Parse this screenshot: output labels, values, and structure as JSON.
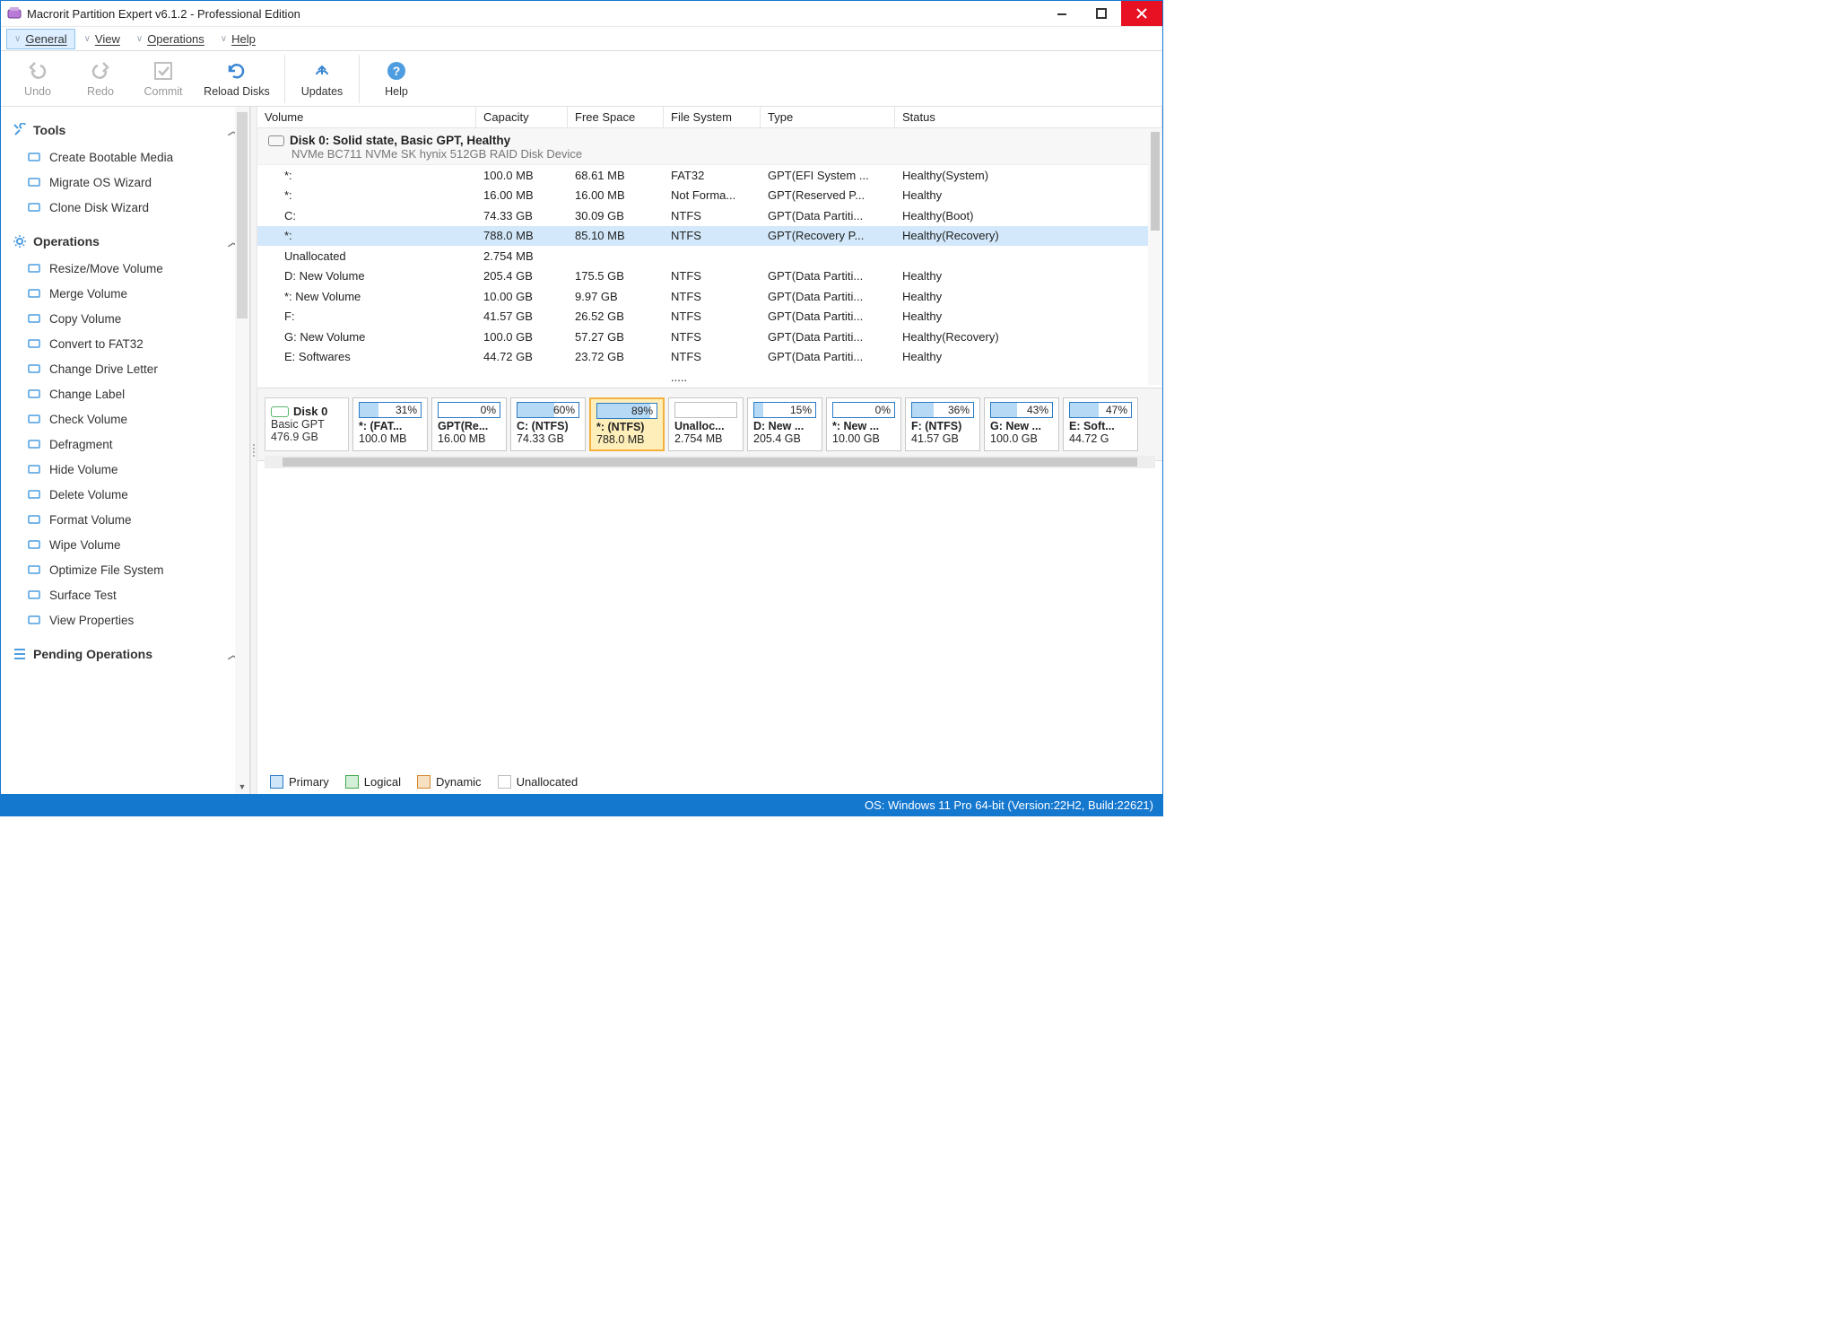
{
  "title": "Macrorit Partition Expert v6.1.2 - Professional Edition",
  "menus": {
    "general": "General",
    "view": "View",
    "operations": "Operations",
    "help": "Help"
  },
  "toolbar": {
    "undo": "Undo",
    "redo": "Redo",
    "commit": "Commit",
    "reload": "Reload Disks",
    "updates": "Updates",
    "help": "Help"
  },
  "sidebar": {
    "tools": {
      "title": "Tools",
      "items": [
        "Create Bootable Media",
        "Migrate OS Wizard",
        "Clone Disk Wizard"
      ]
    },
    "ops": {
      "title": "Operations",
      "items": [
        "Resize/Move Volume",
        "Merge Volume",
        "Copy Volume",
        "Convert to FAT32",
        "Change Drive Letter",
        "Change Label",
        "Check Volume",
        "Defragment",
        "Hide Volume",
        "Delete Volume",
        "Format Volume",
        "Wipe Volume",
        "Optimize File System",
        "Surface Test",
        "View Properties"
      ]
    },
    "pending": {
      "title": "Pending Operations"
    }
  },
  "columns": [
    "Volume",
    "Capacity",
    "Free Space",
    "File System",
    "Type",
    "Status"
  ],
  "disk": {
    "title": "Disk 0: Solid state, Basic GPT, Healthy",
    "sub": "NVMe BC711 NVMe SK hynix 512GB RAID Disk Device",
    "graph_name": "Disk 0",
    "graph_sub1": "Basic GPT",
    "graph_sub2": "476.9 GB"
  },
  "volumes": [
    {
      "name": "*:",
      "cap": "100.0 MB",
      "free": "68.61 MB",
      "fs": "FAT32",
      "type": "GPT(EFI System ...",
      "status": "Healthy(System)"
    },
    {
      "name": "*:",
      "cap": "16.00 MB",
      "free": "16.00 MB",
      "fs": "Not Forma...",
      "type": "GPT(Reserved P...",
      "status": "Healthy"
    },
    {
      "name": "C:",
      "cap": "74.33 GB",
      "free": "30.09 GB",
      "fs": "NTFS",
      "type": "GPT(Data Partiti...",
      "status": "Healthy(Boot)"
    },
    {
      "name": "*:",
      "cap": "788.0 MB",
      "free": "85.10 MB",
      "fs": "NTFS",
      "type": "GPT(Recovery P...",
      "status": "Healthy(Recovery)",
      "selected": true
    },
    {
      "name": "Unallocated",
      "cap": "2.754 MB",
      "free": "",
      "fs": "",
      "type": "",
      "status": ""
    },
    {
      "name": "D: New Volume",
      "cap": "205.4 GB",
      "free": "175.5 GB",
      "fs": "NTFS",
      "type": "GPT(Data Partiti...",
      "status": "Healthy"
    },
    {
      "name": "*: New Volume",
      "cap": "10.00 GB",
      "free": "9.97 GB",
      "fs": "NTFS",
      "type": "GPT(Data Partiti...",
      "status": "Healthy"
    },
    {
      "name": "F:",
      "cap": "41.57 GB",
      "free": "26.52 GB",
      "fs": "NTFS",
      "type": "GPT(Data Partiti...",
      "status": "Healthy"
    },
    {
      "name": "G: New Volume",
      "cap": "100.0 GB",
      "free": "57.27 GB",
      "fs": "NTFS",
      "type": "GPT(Data Partiti...",
      "status": "Healthy(Recovery)"
    },
    {
      "name": "E: Softwares",
      "cap": "44.72 GB",
      "free": "23.72 GB",
      "fs": "NTFS",
      "type": "GPT(Data Partiti...",
      "status": "Healthy"
    },
    {
      "name": "",
      "cap": "",
      "free": "",
      "fs": ".....",
      "type": "",
      "status": ""
    }
  ],
  "partitions": [
    {
      "pct": "31%",
      "fill": 31,
      "name": "*: (FAT...",
      "size": "100.0 MB"
    },
    {
      "pct": "0%",
      "fill": 0,
      "name": "GPT(Re...",
      "size": "16.00 MB"
    },
    {
      "pct": "60%",
      "fill": 60,
      "name": "C: (NTFS)",
      "size": "74.33 GB"
    },
    {
      "pct": "89%",
      "fill": 89,
      "name": "*: (NTFS)",
      "size": "788.0 MB",
      "selected": true
    },
    {
      "pct": "",
      "fill": 0,
      "name": "Unalloc...",
      "size": "2.754 MB",
      "unalloc": true
    },
    {
      "pct": "15%",
      "fill": 15,
      "name": "D: New ...",
      "size": "205.4 GB"
    },
    {
      "pct": "0%",
      "fill": 0,
      "name": "*: New ...",
      "size": "10.00 GB"
    },
    {
      "pct": "36%",
      "fill": 36,
      "name": "F: (NTFS)",
      "size": "41.57 GB"
    },
    {
      "pct": "43%",
      "fill": 43,
      "name": "G: New ...",
      "size": "100.0 GB"
    },
    {
      "pct": "47%",
      "fill": 47,
      "name": "E: Soft...",
      "size": "44.72 G"
    }
  ],
  "legend": {
    "primary": "Primary",
    "logical": "Logical",
    "dynamic": "Dynamic",
    "unalloc": "Unallocated"
  },
  "status": "OS: Windows 11 Pro 64-bit (Version:22H2, Build:22621)"
}
